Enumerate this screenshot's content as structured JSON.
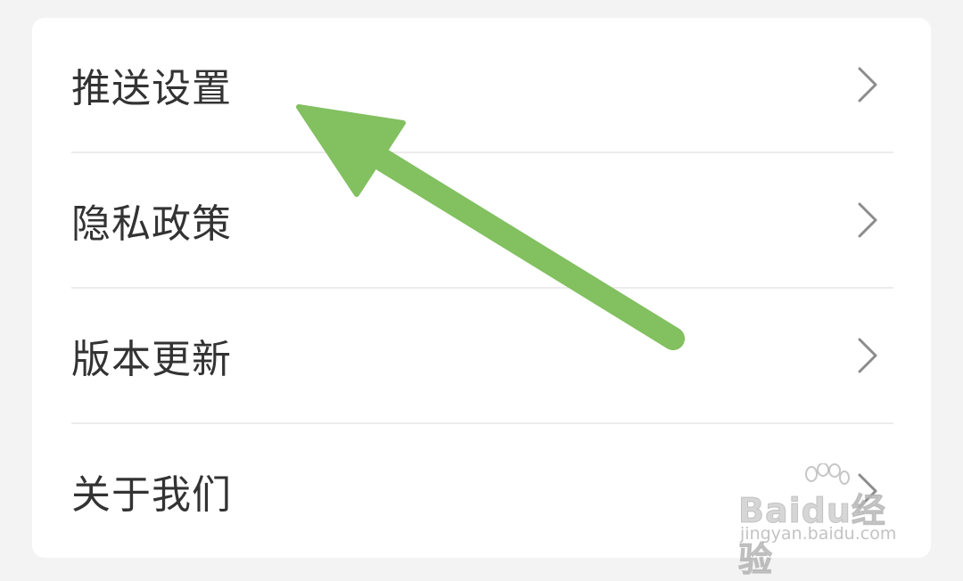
{
  "menu": {
    "items": [
      {
        "label": "推送设置",
        "icon": "chevron-right-icon"
      },
      {
        "label": "隐私政策",
        "icon": "chevron-right-icon"
      },
      {
        "label": "版本更新",
        "icon": "chevron-right-icon"
      },
      {
        "label": "关于我们",
        "icon": "chevron-right-icon"
      }
    ]
  },
  "overlay": {
    "arrow_color": "#82c060",
    "points_to": "推送设置"
  },
  "watermark": {
    "brand": "Baidu经验",
    "url": "jingyan.baidu.com"
  },
  "colors": {
    "background": "#f3f3f3",
    "card": "#ffffff",
    "text": "#333333",
    "chevron": "#8c8c8c",
    "divider": "#ececec"
  }
}
